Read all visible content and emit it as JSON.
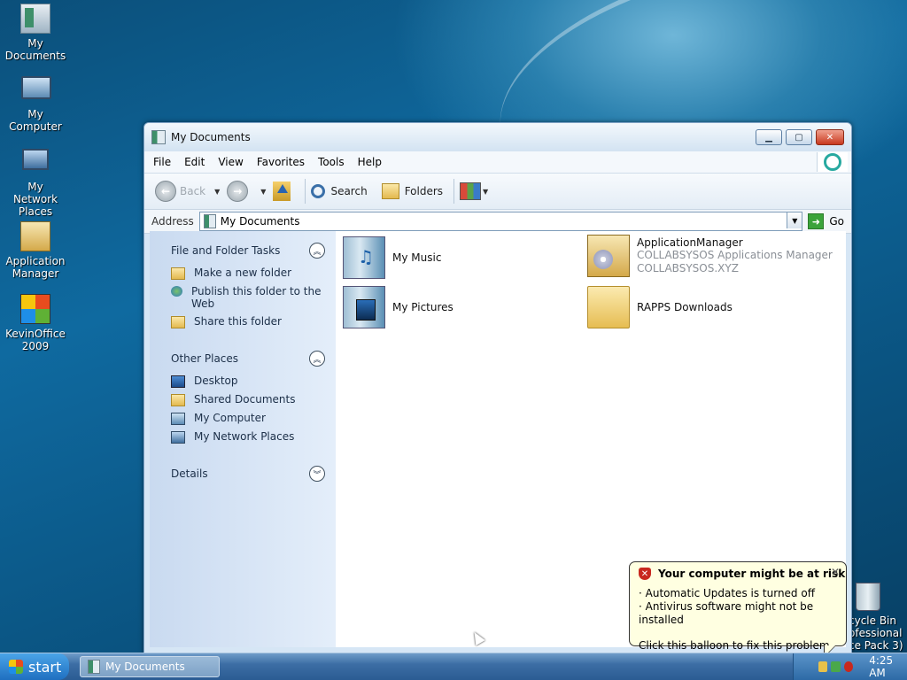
{
  "desktop": {
    "icons": [
      {
        "label": "My Documents",
        "icon": "my-documents-icon"
      },
      {
        "label": "My Computer",
        "icon": "my-computer-icon"
      },
      {
        "label": "My Network Places",
        "icon": "network-places-icon"
      },
      {
        "label": "Application Manager",
        "icon": "application-manager-icon"
      },
      {
        "label": "KevinOffice 2009",
        "icon": "office-icon"
      }
    ],
    "recycle_bin": {
      "line1": "cycle Bin",
      "line2": "ofessional",
      "line3": "ce Pack 3)"
    }
  },
  "window": {
    "title": "My Documents",
    "menu": [
      "File",
      "Edit",
      "View",
      "Favorites",
      "Tools",
      "Help"
    ],
    "toolbar": {
      "back_label": "Back",
      "search_label": "Search",
      "folders_label": "Folders"
    },
    "address": {
      "label": "Address",
      "value": "My Documents",
      "go_label": "Go"
    },
    "taskpane": {
      "sections": [
        {
          "title": "File and Folder Tasks",
          "toggle": "︽",
          "items": [
            {
              "label": "Make a new folder",
              "icon": "new-folder-icon"
            },
            {
              "label": "Publish this folder to the Web",
              "icon": "globe-icon"
            },
            {
              "label": "Share this folder",
              "icon": "share-folder-icon"
            }
          ]
        },
        {
          "title": "Other Places",
          "toggle": "︽",
          "items": [
            {
              "label": "Desktop",
              "icon": "desktop-icon"
            },
            {
              "label": "Shared Documents",
              "icon": "shared-folder-icon"
            },
            {
              "label": "My Computer",
              "icon": "computer-icon"
            },
            {
              "label": "My Network Places",
              "icon": "network-icon"
            }
          ]
        },
        {
          "title": "Details",
          "toggle": "︾",
          "items": []
        }
      ]
    },
    "files": [
      {
        "name": "My Music",
        "icon": "music-folder-icon"
      },
      {
        "name": "ApplicationManager",
        "sub1": "COLLABSYSOS Applications Manager",
        "sub2": "COLLABSYSOS.XYZ",
        "icon": "application-package-icon"
      },
      {
        "name": "My Pictures",
        "icon": "pictures-folder-icon"
      },
      {
        "name": "RAPPS Downloads",
        "icon": "folder-icon"
      }
    ]
  },
  "balloon": {
    "title": "Your computer might be at risk",
    "line1": "· Automatic Updates is turned off",
    "line2": "· Antivirus software might not be installed",
    "footer": "Click this balloon to fix this problem.",
    "close": "✕"
  },
  "taskbar": {
    "start_label": "start",
    "task_label": "My Documents",
    "clock": "4:25 AM"
  }
}
